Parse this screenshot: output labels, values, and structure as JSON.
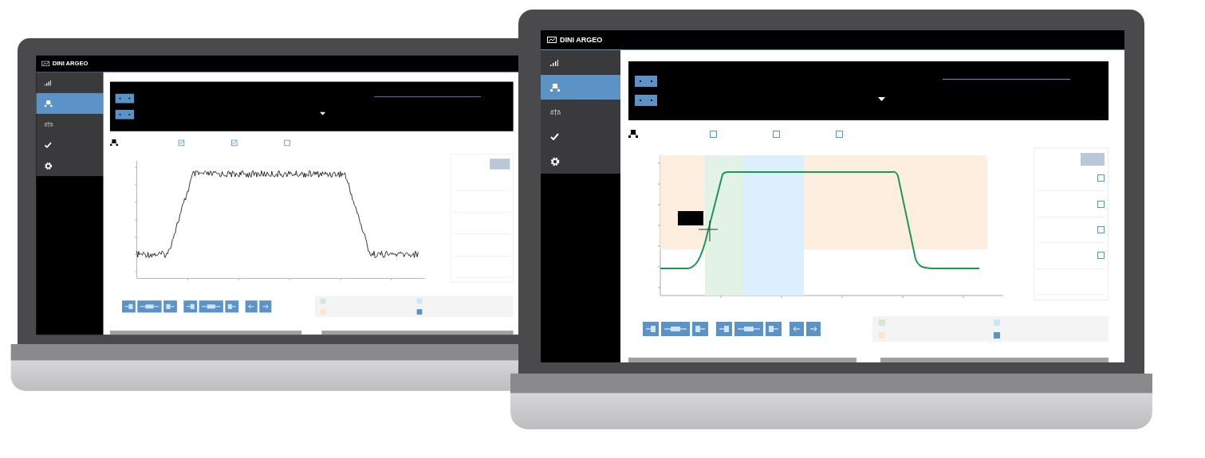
{
  "laptops": [
    {
      "logo": "DINI ARGEO",
      "nav": [
        {
          "kind": "signal",
          "selected": false
        },
        {
          "kind": "network",
          "selected": true
        },
        {
          "kind": "scale",
          "selected": false
        },
        {
          "kind": "check",
          "selected": false
        },
        {
          "kind": "gear",
          "selected": false
        }
      ],
      "options": [
        {
          "checked": true
        },
        {
          "checked": true
        },
        {
          "checked": false
        }
      ],
      "chart": {
        "kind": "raw"
      },
      "legend": [
        {
          "color": "#cfe9d6"
        },
        {
          "color": "#cde6f6"
        },
        {
          "color": "#fde6cf"
        },
        {
          "color": "#5b93c7"
        }
      ]
    },
    {
      "logo": "DINI ARGEO",
      "nav": [
        {
          "kind": "signal",
          "selected": false
        },
        {
          "kind": "network",
          "selected": true
        },
        {
          "kind": "scale",
          "selected": false
        },
        {
          "kind": "check",
          "selected": false
        },
        {
          "kind": "gear",
          "selected": false
        }
      ],
      "options": [
        {
          "checked": false
        },
        {
          "checked": false
        },
        {
          "checked": false
        }
      ],
      "chart": {
        "kind": "filtered"
      },
      "table_checks": [
        {
          "checked": false
        },
        {
          "checked": false
        },
        {
          "checked": false
        },
        {
          "checked": false
        }
      ],
      "legend": [
        {
          "color": "#cfe9d6"
        },
        {
          "color": "#cde6f6"
        },
        {
          "color": "#fde6cf"
        },
        {
          "color": "#5b93c7"
        }
      ]
    }
  ]
}
